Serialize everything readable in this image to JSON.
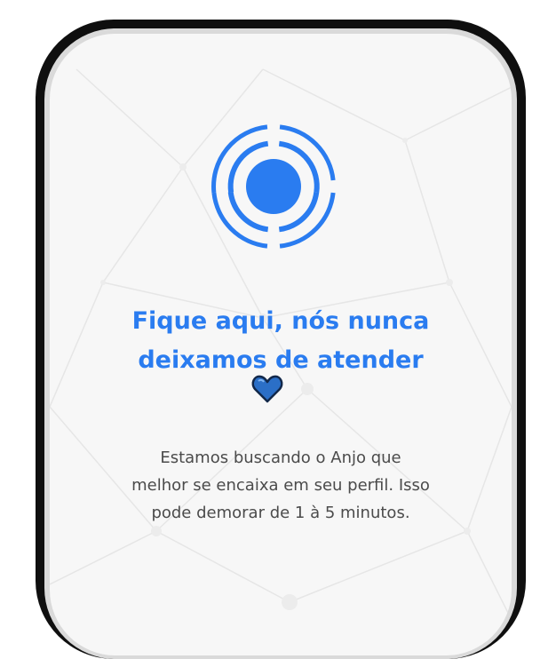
{
  "screen": {
    "headline_lines": [
      "Fique aqui, nós nunca",
      "deixamos de atender"
    ],
    "heart_icon": "blue-heart-icon",
    "description_lines": [
      "Estamos buscando o Anjo que",
      "melhor se encaixa em seu perfil. Isso",
      "pode demorar de 1 à 5 minutos."
    ],
    "indicator_icon": "searching-radar-icon"
  },
  "colors": {
    "accent": "#2a7cf0",
    "heart": "#2b6fc7",
    "text": "#4b4b4b",
    "screen_background": "#f7f7f7",
    "frame": "#0f0f0f"
  }
}
